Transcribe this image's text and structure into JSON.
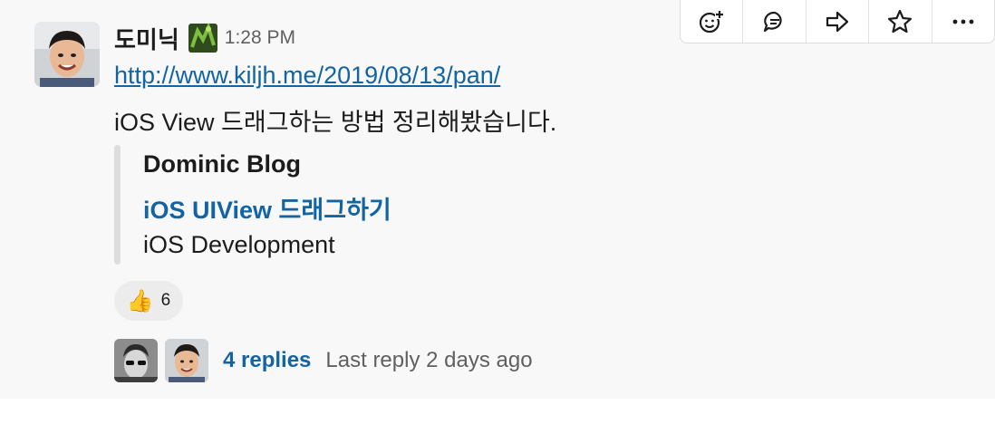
{
  "message": {
    "sender": "도미닉",
    "time": "1:28 PM",
    "link": "http://www.kiljh.me/2019/08/13/pan/",
    "text": "iOS View 드래그하는 방법 정리해봤습니다."
  },
  "attachment": {
    "site_name": "Dominic Blog",
    "title": "iOS UIView 드래그하기",
    "description": "iOS Development"
  },
  "reaction": {
    "emoji": "👍",
    "count": "6"
  },
  "thread": {
    "replies_label": "4 replies",
    "last_reply": "Last reply 2 days ago"
  },
  "toolbar": {
    "icons": [
      "add-reaction-icon",
      "reply-in-thread-icon",
      "share-icon",
      "star-icon",
      "more-icon"
    ]
  },
  "colors": {
    "link": "#1264a3",
    "text": "#1d1c1d",
    "muted": "#616061",
    "hover_bg": "#f8f8f8"
  }
}
